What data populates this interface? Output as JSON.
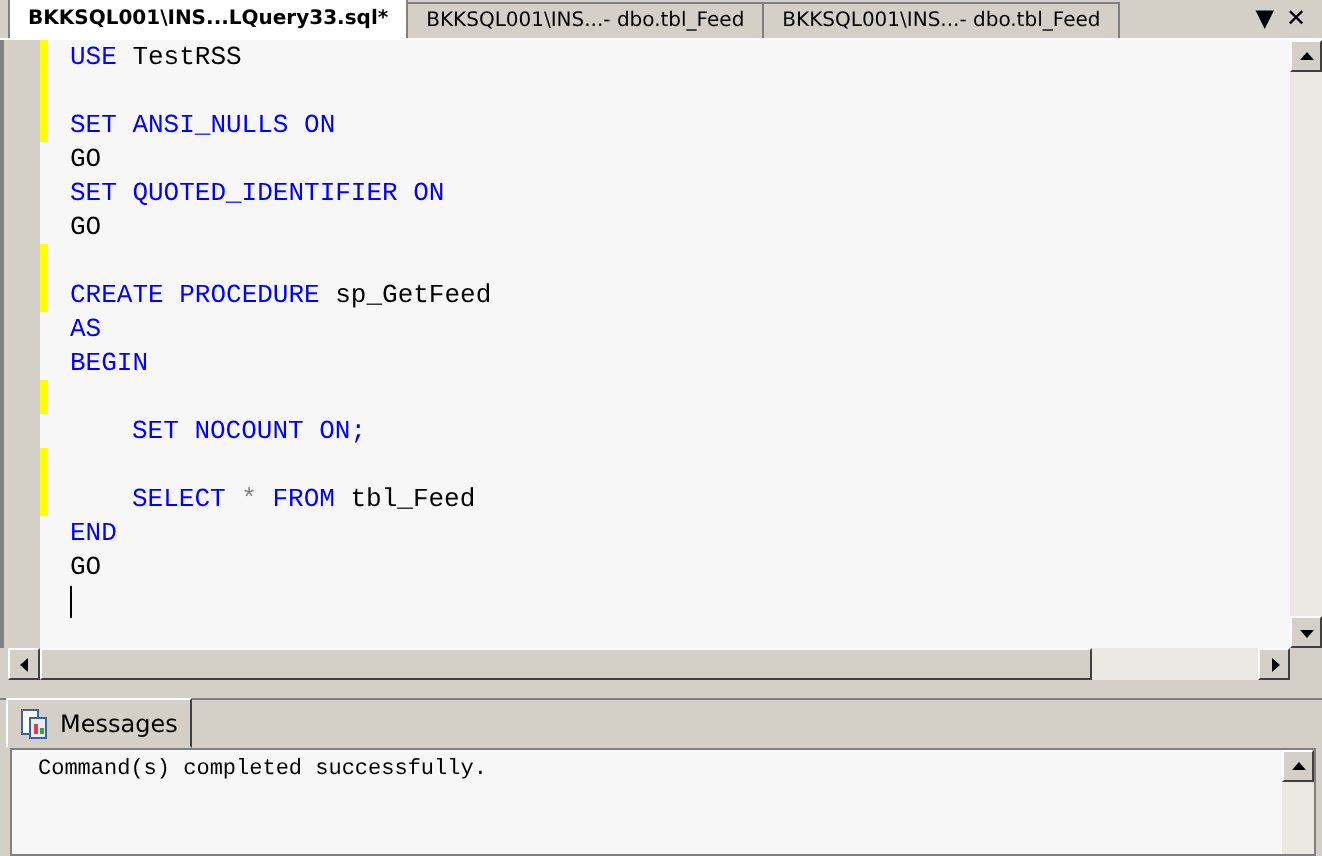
{
  "tabs": [
    {
      "label": "BKKSQL001\\INS...LQuery33.sql*",
      "selected": true
    },
    {
      "label": "BKKSQL001\\INS...- dbo.tbl_Feed",
      "selected": false
    },
    {
      "label": "BKKSQL001\\INS...- dbo.tbl_Feed",
      "selected": false
    }
  ],
  "tab_controls": [
    "▼",
    "✕"
  ],
  "editor": {
    "lines": [
      {
        "changed": true,
        "indented": false,
        "tokens": [
          {
            "kind": "keyword",
            "text": "USE"
          },
          {
            "kind": "plain",
            "text": "TestRSS"
          }
        ]
      },
      {
        "changed": true,
        "indented": false
      },
      {
        "changed": true,
        "indented": false,
        "tokens": [
          {
            "kind": "keyword",
            "text": "SET"
          },
          {
            "kind": "keyword",
            "text": "ANSI_NULLS"
          },
          {
            "kind": "keyword",
            "text": "ON"
          }
        ]
      },
      {
        "changed": false,
        "indented": false,
        "tokens": [
          {
            "kind": "plain",
            "text": "GO"
          }
        ]
      },
      {
        "changed": false,
        "indented": false,
        "tokens": [
          {
            "kind": "keyword",
            "text": "SET"
          },
          {
            "kind": "keyword",
            "text": "QUOTED_IDENTIFIER"
          },
          {
            "kind": "keyword",
            "text": "ON"
          }
        ]
      },
      {
        "changed": false,
        "indented": false,
        "tokens": [
          {
            "kind": "plain",
            "text": "GO"
          }
        ]
      },
      {
        "changed": true,
        "indented": false
      },
      {
        "changed": true,
        "indented": false,
        "tokens": [
          {
            "kind": "keyword",
            "text": "CREATE"
          },
          {
            "kind": "keyword",
            "text": "PROCEDURE"
          },
          {
            "kind": "plain",
            "text": "sp_GetFeed"
          }
        ]
      },
      {
        "changed": false,
        "indented": false,
        "tokens": [
          {
            "kind": "keyword",
            "text": "AS"
          }
        ]
      },
      {
        "changed": false,
        "indented": false,
        "tokens": [
          {
            "kind": "keyword",
            "text": "BEGIN"
          }
        ]
      },
      {
        "changed": true,
        "indented": false
      },
      {
        "changed": false,
        "indented": true,
        "tokens": [
          {
            "kind": "keyword",
            "text": "SET"
          },
          {
            "kind": "keyword",
            "text": "NOCOUNT"
          },
          {
            "kind": "keyword",
            "text": "ON;"
          }
        ]
      },
      {
        "changed": true,
        "indented": false
      },
      {
        "changed": true,
        "indented": true,
        "tokens": [
          {
            "kind": "keyword",
            "text": "SELECT"
          },
          {
            "kind": "operator",
            "text": "*"
          },
          {
            "kind": "keyword",
            "text": "FROM"
          },
          {
            "kind": "plain",
            "text": "tbl_Feed"
          }
        ]
      },
      {
        "changed": false,
        "indented": false,
        "tokens": [
          {
            "kind": "keyword",
            "text": "END"
          }
        ]
      },
      {
        "changed": false,
        "indented": false,
        "tokens": [
          {
            "kind": "plain",
            "text": "GO"
          }
        ]
      },
      {
        "changed": false,
        "indented": false,
        "cursor": true
      }
    ]
  },
  "results": {
    "tab": {
      "label": "Messages",
      "selected": true
    },
    "message": "Command(s) completed successfully."
  }
}
